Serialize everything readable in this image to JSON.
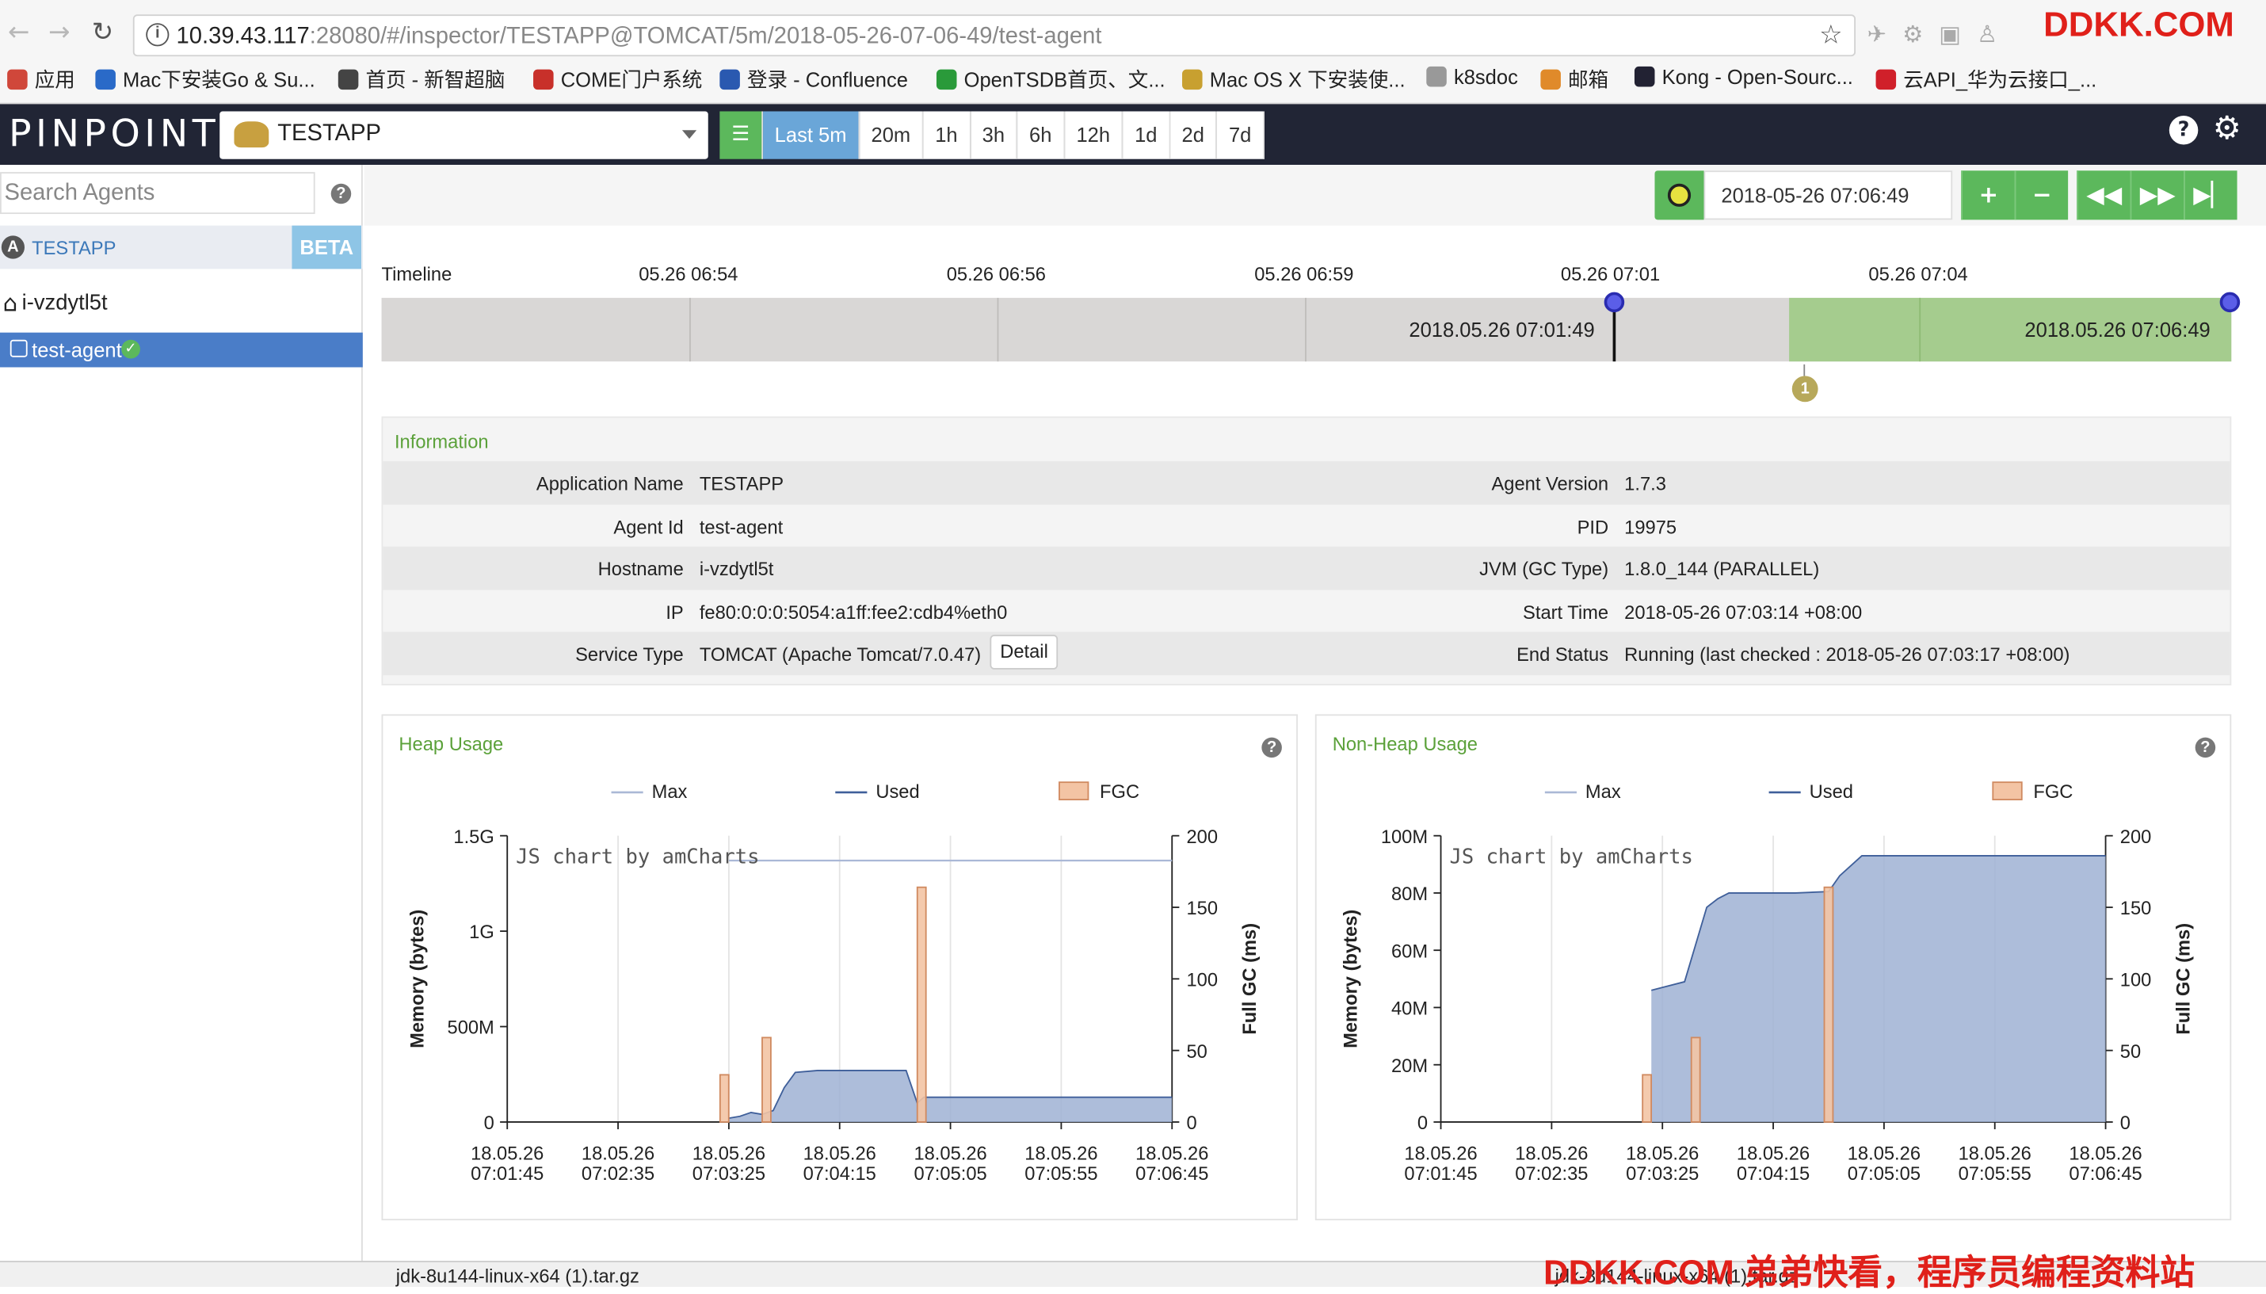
{
  "browser": {
    "url_host": "10.39.43.117",
    "url_rest": ":28080/#/inspector/TESTAPP@TOMCAT/5m/2018-05-26-07-06-49/test-agent",
    "watermark": "DDKK.COM",
    "bookmarks": [
      {
        "label": "应用",
        "color": "#d0473a"
      },
      {
        "label": "Mac下安装Go & Su...",
        "color": "#2a6ac8"
      },
      {
        "label": "首页 - 新智超脑",
        "color": "#444"
      },
      {
        "label": "COME门户系统",
        "color": "#c8302a"
      },
      {
        "label": "登录 - Confluence",
        "color": "#2a59b0"
      },
      {
        "label": "OpenTSDB首页、文...",
        "color": "#2a9a3a"
      },
      {
        "label": "Mac OS X 下安装使...",
        "color": "#c8a030"
      },
      {
        "label": "k8sdoc",
        "color": "#999"
      },
      {
        "label": "邮箱",
        "color": "#e08a2a"
      },
      {
        "label": "Kong - Open-Sourc...",
        "color": "#223"
      },
      {
        "label": "云API_华为云接口_...",
        "color": "#d0202a"
      }
    ]
  },
  "header": {
    "logo": "PINPOINT",
    "app_name": "TESTAPP",
    "ranges": [
      "Last 5m",
      "20m",
      "1h",
      "3h",
      "6h",
      "12h",
      "1d",
      "2d",
      "7d"
    ],
    "active_range": "Last 5m"
  },
  "sidebar": {
    "search_placeholder": "Search Agents",
    "app_label": "TESTAPP",
    "beta": "BETA",
    "host": "i-vzdytl5t",
    "agent": "test-agent"
  },
  "time_control": {
    "date": "2018-05-26 07:06:49"
  },
  "timeline": {
    "label": "Timeline",
    "ticks": [
      "05.26 06:54",
      "05.26 06:56",
      "05.26 06:59",
      "05.26 07:01",
      "05.26 07:04"
    ],
    "start_label": "2018.05.26 07:01:49",
    "end_label": "2018.05.26 07:06:49",
    "badge": "1"
  },
  "info": {
    "title": "Information",
    "left": [
      {
        "k": "Application Name",
        "v": "TESTAPP"
      },
      {
        "k": "Agent Id",
        "v": "test-agent"
      },
      {
        "k": "Hostname",
        "v": "i-vzdytl5t"
      },
      {
        "k": "IP",
        "v": "fe80:0:0:0:5054:a1ff:fee2:cdb4%eth0"
      },
      {
        "k": "Service Type",
        "v": "TOMCAT  (Apache Tomcat/7.0.47)"
      }
    ],
    "right": [
      {
        "k": "Agent Version",
        "v": "1.7.3"
      },
      {
        "k": "PID",
        "v": "19975"
      },
      {
        "k": "JVM (GC Type)",
        "v": "1.8.0_144 (PARALLEL)"
      },
      {
        "k": "Start Time",
        "v": "2018-05-26 07:03:14 +08:00"
      },
      {
        "k": "End Status",
        "v": "Running (last checked : 2018-05-26 07:03:17 +08:00)"
      }
    ],
    "detail_button": "Detail"
  },
  "chart_data": [
    {
      "type": "area",
      "title": "Heap Usage",
      "watermark": "JS chart by amCharts",
      "ylabel": "Memory (bytes)",
      "y2label": "Full GC (ms)",
      "legend": [
        "Max",
        "Used",
        "FGC"
      ],
      "y_ticks": [
        "0",
        "500M",
        "1G",
        "1.5G"
      ],
      "y_max": 1.5,
      "y2_ticks": [
        "0",
        "50",
        "100",
        "150",
        "200"
      ],
      "y2_max": 200,
      "x_ticks": [
        [
          "18.05.26",
          "07:01:45"
        ],
        [
          "18.05.26",
          "07:02:35"
        ],
        [
          "18.05.26",
          "07:03:25"
        ],
        [
          "18.05.26",
          "07:04:15"
        ],
        [
          "18.05.26",
          "07:05:05"
        ],
        [
          "18.05.26",
          "07:05:55"
        ],
        [
          "18.05.26",
          "07:06:45"
        ]
      ],
      "x_range": [
        0,
        300
      ],
      "max_series": {
        "x": [
          100,
          300
        ],
        "y": [
          1.37,
          1.37
        ]
      },
      "used_series": {
        "x": [
          100,
          105,
          110,
          115,
          120,
          125,
          130,
          140,
          160,
          180,
          185,
          188,
          200,
          250,
          300
        ],
        "y": [
          0.02,
          0.03,
          0.05,
          0.04,
          0.06,
          0.18,
          0.26,
          0.27,
          0.27,
          0.27,
          0.1,
          0.13,
          0.13,
          0.13,
          0.13
        ]
      },
      "fgc": [
        {
          "x": 98,
          "v": 33
        },
        {
          "x": 117,
          "v": 59
        },
        {
          "x": 187,
          "v": 164
        }
      ]
    },
    {
      "type": "area",
      "title": "Non-Heap Usage",
      "watermark": "JS chart by amCharts",
      "ylabel": "Memory (bytes)",
      "y2label": "Full GC (ms)",
      "legend": [
        "Max",
        "Used",
        "FGC"
      ],
      "y_ticks": [
        "0",
        "20M",
        "40M",
        "60M",
        "80M",
        "100M"
      ],
      "y_max": 100,
      "y2_ticks": [
        "0",
        "50",
        "100",
        "150",
        "200"
      ],
      "y2_max": 200,
      "x_ticks": [
        [
          "18.05.26",
          "07:01:45"
        ],
        [
          "18.05.26",
          "07:02:35"
        ],
        [
          "18.05.26",
          "07:03:25"
        ],
        [
          "18.05.26",
          "07:04:15"
        ],
        [
          "18.05.26",
          "07:05:05"
        ],
        [
          "18.05.26",
          "07:05:55"
        ],
        [
          "18.05.26",
          "07:06:45"
        ]
      ],
      "x_range": [
        0,
        300
      ],
      "used_series": {
        "x": [
          95,
          100,
          110,
          115,
          120,
          125,
          130,
          140,
          160,
          175,
          180,
          190,
          220,
          300
        ],
        "y": [
          46,
          47,
          49,
          62,
          75,
          78,
          80,
          80,
          80,
          80.5,
          86,
          93,
          93,
          93
        ]
      },
      "fgc": [
        {
          "x": 93,
          "v": 33
        },
        {
          "x": 115,
          "v": 59
        },
        {
          "x": 175,
          "v": 164
        }
      ]
    }
  ],
  "footer": {
    "download1": "jdk-8u144-linux-x64 (1).tar.gz",
    "download2": "jdk-8u144-linux-x64 (1).tar.gz",
    "watermark": "DDKK.COM 弟弟快看，程序员编程资料站"
  }
}
